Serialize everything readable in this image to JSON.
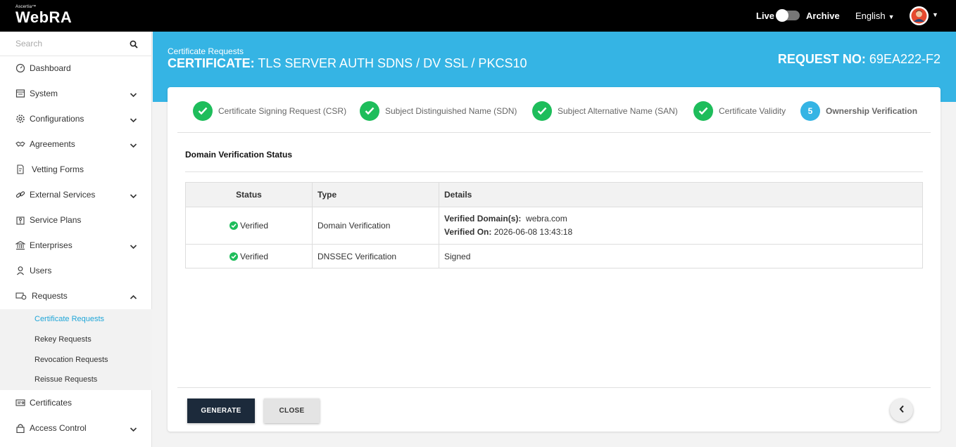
{
  "topbar": {
    "logo_small": "Ascertia™",
    "logo_big": "WebRA",
    "live_label": "Live",
    "archive_label": "Archive",
    "language": "English"
  },
  "sidebar": {
    "search_placeholder": "Search",
    "items": [
      {
        "label": "Dashboard",
        "icon": "dashboard-icon"
      },
      {
        "label": "System",
        "icon": "system-icon"
      },
      {
        "label": "Configurations",
        "icon": "gear-icon"
      },
      {
        "label": "Agreements",
        "icon": "handshake-icon"
      },
      {
        "label": "Vetting Forms",
        "icon": "form-icon"
      },
      {
        "label": "External Services",
        "icon": "link-icon"
      },
      {
        "label": "Service Plans",
        "icon": "service-plans-icon"
      },
      {
        "label": "Enterprises",
        "icon": "bank-icon"
      },
      {
        "label": "Users",
        "icon": "user-icon"
      },
      {
        "label": "Requests",
        "icon": "requests-icon"
      },
      {
        "label": "Certificates",
        "icon": "certificate-icon"
      },
      {
        "label": "Access Control",
        "icon": "lock-icon"
      }
    ],
    "subitems": [
      {
        "label": "Certificate Requests",
        "active": true
      },
      {
        "label": "Rekey Requests"
      },
      {
        "label": "Revocation Requests"
      },
      {
        "label": "Reissue Requests"
      }
    ]
  },
  "banner": {
    "breadcrumb": "Certificate Requests",
    "cert_prefix": "CERTIFICATE:",
    "cert_name": "TLS SERVER AUTH SDNS / DV SSL / PKCS10",
    "req_prefix": "REQUEST NO:",
    "req_number": "69EA222-F2"
  },
  "steps": [
    {
      "label": "Certificate Signing Request (CSR)",
      "done": true
    },
    {
      "label": "Subject Distinguished Name (SDN)",
      "done": true
    },
    {
      "label": "Subject Alternative Name (SAN)",
      "done": true
    },
    {
      "label": "Certificate Validity",
      "done": true
    },
    {
      "label": "Ownership Verification",
      "number": "5",
      "active": true
    }
  ],
  "section_title": "Domain Verification Status",
  "table": {
    "headers": [
      "Status",
      "Type",
      "Details"
    ],
    "rows": [
      {
        "status": "Verified",
        "type": "Domain Verification",
        "details_label1": "Verified Domain(s):",
        "details_value1": "webra.com",
        "details_label2": "Verified On:",
        "details_value2": "2026-06-08 13:43:18"
      },
      {
        "status": "Verified",
        "type": "DNSSEC Verification",
        "details": "Signed"
      }
    ]
  },
  "buttons": {
    "generate": "GENERATE",
    "close": "CLOSE"
  },
  "colors": {
    "topbar": "#000000",
    "banner": "#35b4e4",
    "success": "#1ebd5b",
    "active_link": "#1fa6d8",
    "primary_button": "#1c2a3b"
  }
}
